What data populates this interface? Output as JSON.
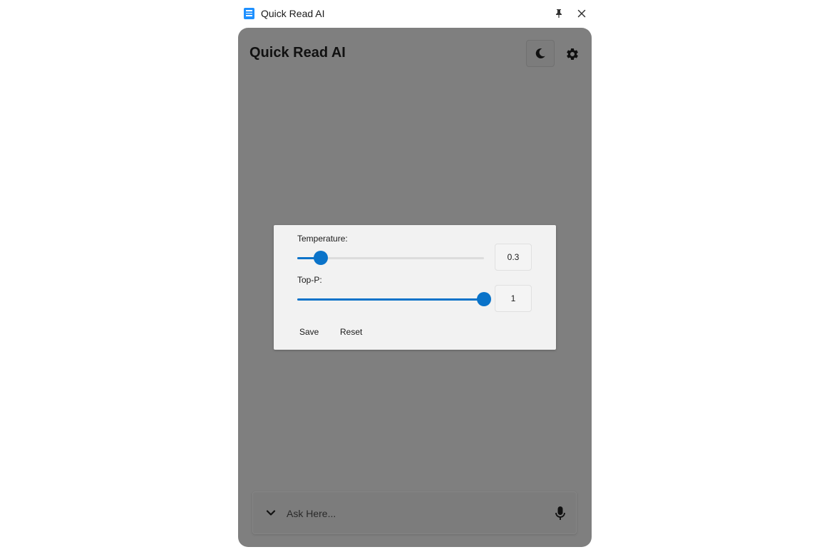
{
  "window": {
    "title": "Quick Read AI",
    "pin_icon": "pin-icon",
    "close_icon": "close-icon"
  },
  "header": {
    "title": "Quick Read AI",
    "theme_icon": "moon-icon",
    "settings_icon": "gear-icon"
  },
  "settings_dialog": {
    "temperature_label": "Temperature:",
    "temperature_value": "0.3",
    "temperature_fraction": 0.125,
    "top_p_label": "Top-P:",
    "top_p_value": "1",
    "top_p_fraction": 1.0,
    "save_label": "Save",
    "reset_label": "Reset"
  },
  "input_bar": {
    "placeholder": "Ask Here...",
    "value": "",
    "expand_icon": "chevron-down-icon",
    "mic_icon": "microphone-icon"
  },
  "colors": {
    "accent": "#0a73c9",
    "overlay": "#7f7f7f",
    "dialog_background": "#f2f2f2",
    "app_icon": "#1e90ff"
  }
}
